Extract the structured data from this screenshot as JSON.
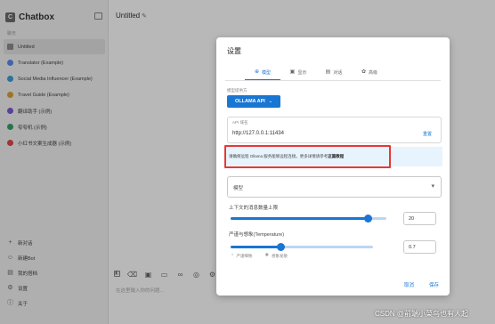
{
  "app": {
    "name": "Chatbox",
    "conversations_section": "聊天"
  },
  "sidebar": {
    "conversations": [
      {
        "label": "Untitled",
        "icon": "chat-bubble-icon",
        "color": "#8d8d8d",
        "active": true
      },
      {
        "label": "Translator (Example)",
        "icon": "avatar-icon",
        "color": "#5b8def"
      },
      {
        "label": "Social Media Influencer (Example)",
        "icon": "avatar-icon",
        "color": "#3aa0d8"
      },
      {
        "label": "Travel Guide (Example)",
        "icon": "avatar-icon",
        "color": "#e0a030"
      },
      {
        "label": "翻译助手 (示例)",
        "icon": "avatar-icon",
        "color": "#7a5bd6"
      },
      {
        "label": "夸夸机 (示例)",
        "icon": "avatar-icon",
        "color": "#3aa06a"
      },
      {
        "label": "小红书文案生成器 (示例)",
        "icon": "avatar-icon",
        "color": "#e04848"
      }
    ],
    "bottom": [
      {
        "label": "新对话",
        "icon": "plus-icon"
      },
      {
        "label": "新建Bot",
        "icon": "bot-icon"
      },
      {
        "label": "我的搭档",
        "icon": "folder-icon"
      },
      {
        "label": "设置",
        "icon": "gear-icon"
      },
      {
        "label": "关于",
        "icon": "info-icon"
      }
    ]
  },
  "main": {
    "title": "Untitled",
    "composer_placeholder": "在这里输入你的问题..."
  },
  "dialog": {
    "title": "设置",
    "tabs": [
      {
        "label": "模型",
        "icon": "model-icon",
        "active": true
      },
      {
        "label": "显示",
        "icon": "display-icon"
      },
      {
        "label": "对话",
        "icon": "chat-icon"
      },
      {
        "label": "高级",
        "icon": "advanced-icon"
      }
    ],
    "ai_provider_label": "模型提供方",
    "ai_provider_value": "OLLAMA API",
    "api_host_label": "API 域名",
    "api_host_value": "http://127.0.0.1:11434",
    "api_host_reset": "重置",
    "notice_text": "请确保远程 Ollama 服务能够远程连接。更多详情请参考",
    "notice_link": "这篇教程",
    "model_label": "模型",
    "context_label": "上下文的消息数量上限",
    "context_value": "20",
    "context_fraction": 0.88,
    "temperature_label": "严谨与想象(Temperature)",
    "temperature_value": "0.7",
    "temperature_fraction": 0.35,
    "temp_presets": [
      "严谨细致",
      "想象发散"
    ],
    "cancel_label": "取消",
    "save_label": "保存"
  },
  "watermark": "CSDN @前端小菜鸟也有人起",
  "colors": {
    "accent": "#1976d2",
    "highlight_border": "#e53935",
    "notice_bg": "#e8f4fd"
  }
}
